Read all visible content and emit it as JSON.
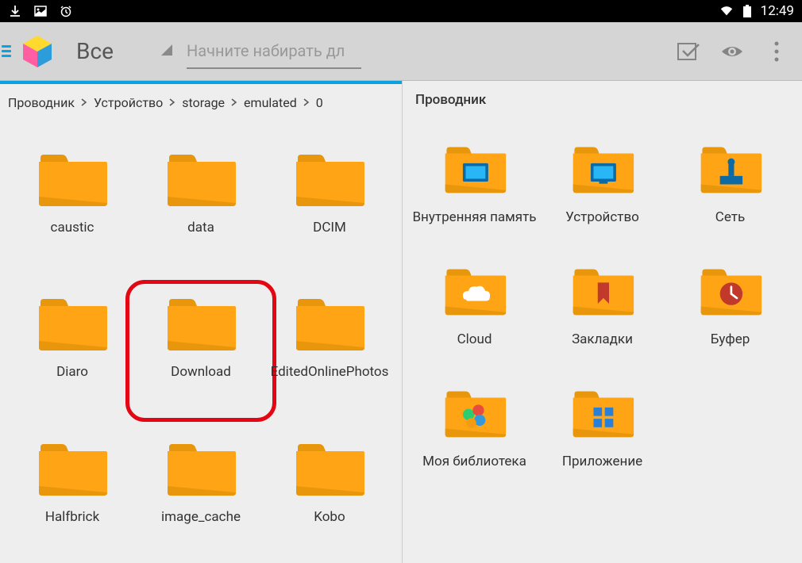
{
  "status": {
    "time": "12:49"
  },
  "toolbar": {
    "filter_label": "Все",
    "search_placeholder": "Начните набирать дл"
  },
  "breadcrumb": [
    "Проводник",
    "Устройство",
    "storage",
    "emulated",
    "0"
  ],
  "folders": [
    {
      "name": "caustic",
      "highlighted": false
    },
    {
      "name": "data",
      "highlighted": false
    },
    {
      "name": "DCIM",
      "highlighted": false
    },
    {
      "name": "Diaro",
      "highlighted": false
    },
    {
      "name": "Download",
      "highlighted": true
    },
    {
      "name": "EditedOnlinePhotos",
      "highlighted": false
    },
    {
      "name": "Halfbrick",
      "highlighted": false
    },
    {
      "name": "image_cache",
      "highlighted": false
    },
    {
      "name": "Kobo",
      "highlighted": false
    }
  ],
  "right_panel": {
    "title": "Проводник",
    "items": [
      {
        "name": "Внутренняя память",
        "icon": "internal"
      },
      {
        "name": "Устройство",
        "icon": "device"
      },
      {
        "name": "Сеть",
        "icon": "network"
      },
      {
        "name": "Cloud",
        "icon": "cloud"
      },
      {
        "name": "Закладки",
        "icon": "bookmarks"
      },
      {
        "name": "Буфер",
        "icon": "clipboard"
      },
      {
        "name": "Моя библиотека",
        "icon": "library"
      },
      {
        "name": "Приложение",
        "icon": "apps"
      }
    ]
  }
}
